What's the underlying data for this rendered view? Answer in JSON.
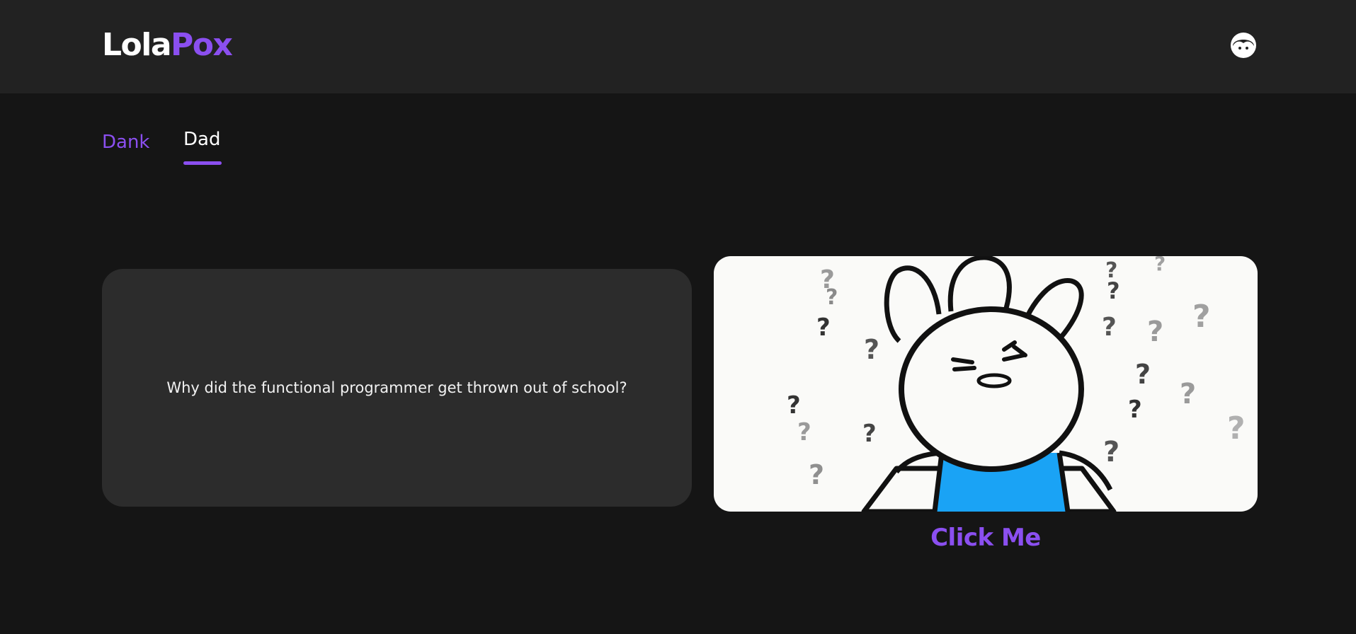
{
  "header": {
    "logo_part_a": "Lola",
    "logo_part_b": "Pox",
    "avatar_icon": "face-avatar-icon"
  },
  "tabs": [
    {
      "label": "Dank",
      "active": false
    },
    {
      "label": "Dad",
      "active": true
    }
  ],
  "joke": {
    "text": "Why did the functional programmer get thrown out of school?"
  },
  "media": {
    "image_subject": "confused-bunny-with-question-marks",
    "button_label": "Click Me"
  },
  "colors": {
    "accent": "#8b4ff0",
    "background": "#151515",
    "header": "#222222",
    "card": "#2c2c2c",
    "shirt": "#1aa3f5"
  }
}
